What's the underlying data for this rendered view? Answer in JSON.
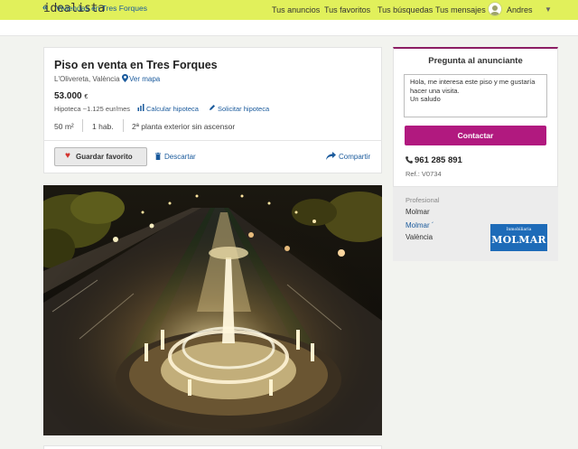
{
  "header": {
    "logo": "idealista",
    "nav": [
      "Tus anuncios",
      "Tus favoritos",
      "Tus búsquedas",
      "Tus mensajes"
    ],
    "user": "Andres",
    "accent_color": "#e1f05b"
  },
  "breadcrumb": {
    "label": "Viviendas en Tres Forques"
  },
  "listing": {
    "title": "Piso en venta en Tres Forques",
    "location": "L'Olivereta, València",
    "map_link": "Ver mapa",
    "price": "53.000",
    "currency": "€",
    "mortgage": "Hipoteca ~1.125 eur/mes",
    "calc_link": "Calcular hipoteca",
    "request_link": "Solicitar hipoteca",
    "features": [
      "50 m²",
      "1 hab.",
      "2ª planta exterior sin ascensor"
    ],
    "favorite_label": "Guardar favorito",
    "discard_label": "Descartar",
    "share_label": "Compartir"
  },
  "contact": {
    "title": "Pregunta al anunciante",
    "message": "Hola, me interesa este piso y me gustaría hacer una visita.\nUn saludo",
    "button": "Contactar",
    "phone": "961 285 891",
    "ref": "Ref.: V0734",
    "accent_color": "#b1197f",
    "professional_label": "Profesional",
    "professional_name": "Molmar",
    "advertiser_link": "Molmar ´",
    "advertiser_city": "València",
    "logo_small": "Inmobiliaria",
    "logo_big": "MOLMAR"
  }
}
